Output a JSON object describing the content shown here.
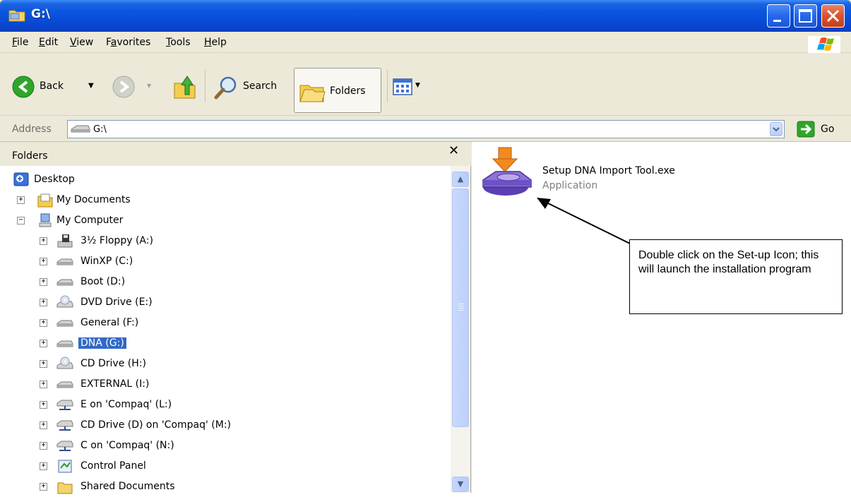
{
  "window": {
    "title": "G:\\"
  },
  "menu": {
    "items": [
      {
        "key": "F",
        "rest": "ile"
      },
      {
        "key": "E",
        "rest": "dit"
      },
      {
        "key": "V",
        "rest": "iew"
      },
      {
        "pre": "F",
        "key": "a",
        "rest": "vorites"
      },
      {
        "key": "T",
        "rest": "ools"
      },
      {
        "key": "H",
        "rest": "elp"
      }
    ]
  },
  "toolbar": {
    "back_label": "Back",
    "search_label": "Search",
    "folders_label": "Folders"
  },
  "address": {
    "label": "Address",
    "value": "G:\\",
    "go_label": "Go"
  },
  "folders_pane": {
    "title": "Folders",
    "close_glyph": "✕",
    "tree": [
      {
        "label": "Desktop",
        "icon": "desktop-icon",
        "level": 0,
        "expander": ""
      },
      {
        "label": "My Documents",
        "icon": "my-documents-icon",
        "level": 1,
        "expander": "+"
      },
      {
        "label": "My Computer",
        "icon": "my-computer-icon",
        "level": 1,
        "expander": "−"
      },
      {
        "label": "3½ Floppy (A:)",
        "icon": "floppy-drive-icon",
        "level": 2,
        "expander": "+"
      },
      {
        "label": "WinXP (C:)",
        "icon": "hard-drive-icon",
        "level": 2,
        "expander": "+"
      },
      {
        "label": "Boot (D:)",
        "icon": "hard-drive-icon",
        "level": 2,
        "expander": "+"
      },
      {
        "label": "DVD Drive (E:)",
        "icon": "dvd-drive-icon",
        "level": 2,
        "expander": "+"
      },
      {
        "label": "General (F:)",
        "icon": "hard-drive-icon",
        "level": 2,
        "expander": "+"
      },
      {
        "label": "DNA (G:)",
        "icon": "hard-drive-icon",
        "level": 2,
        "expander": "+",
        "selected": true
      },
      {
        "label": "CD Drive (H:)",
        "icon": "cd-drive-icon",
        "level": 2,
        "expander": "+"
      },
      {
        "label": "EXTERNAL (I:)",
        "icon": "hard-drive-icon",
        "level": 2,
        "expander": "+"
      },
      {
        "label": "E on 'Compaq' (L:)",
        "icon": "network-drive-icon",
        "level": 2,
        "expander": "+"
      },
      {
        "label": "CD Drive (D) on 'Compaq' (M:)",
        "icon": "network-drive-icon",
        "level": 2,
        "expander": "+"
      },
      {
        "label": "C on 'Compaq' (N:)",
        "icon": "network-drive-icon",
        "level": 2,
        "expander": "+"
      },
      {
        "label": "Control Panel",
        "icon": "control-panel-icon",
        "level": 2,
        "expander": "+"
      },
      {
        "label": "Shared Documents",
        "icon": "folder-icon",
        "level": 2,
        "expander": "+"
      }
    ]
  },
  "content": {
    "file": {
      "name": "Setup DNA Import Tool.exe",
      "type": "Application",
      "icon": "installer-icon"
    },
    "callout_text": "Double click on the Set-up Icon; this will launch the installation program"
  },
  "colors": {
    "titlebar": "#0A57E0",
    "selection": "#316AC5",
    "chrome": "#ECE9D8"
  }
}
